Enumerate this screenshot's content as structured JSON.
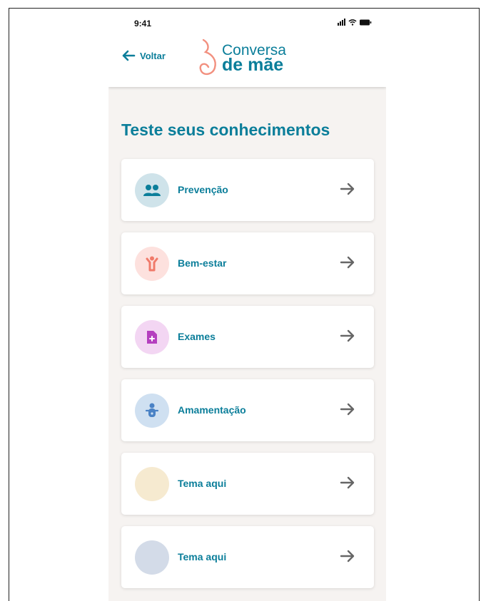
{
  "status": {
    "time": "9:41"
  },
  "header": {
    "back_label": "Voltar",
    "logo_line1": "Conversa",
    "logo_line2": "de mãe"
  },
  "page": {
    "title": "Teste seus conhecimentos"
  },
  "topics": [
    {
      "label": "Prevenção",
      "icon": "people-icon",
      "color": "#cfe3ea",
      "icon_color": "#0b7e9a"
    },
    {
      "label": "Bem-estar",
      "icon": "person-arms-up-icon",
      "color": "#fde1de",
      "icon_color": "#f07a6a"
    },
    {
      "label": "Exames",
      "icon": "medical-document-icon",
      "color": "#f3d6f3",
      "icon_color": "#b53fbf"
    },
    {
      "label": "Amamentação",
      "icon": "baby-icon",
      "color": "#cfe0f1",
      "icon_color": "#4a82c5"
    },
    {
      "label": "Tema aqui",
      "icon": "",
      "color": "#f6ead0",
      "icon_color": ""
    },
    {
      "label": "Tema aqui",
      "icon": "",
      "color": "#d3dbe8",
      "icon_color": ""
    }
  ],
  "colors": {
    "accent": "#0b7e9a",
    "logo_mark": "#f2907f",
    "background": "#f6f3f1"
  }
}
